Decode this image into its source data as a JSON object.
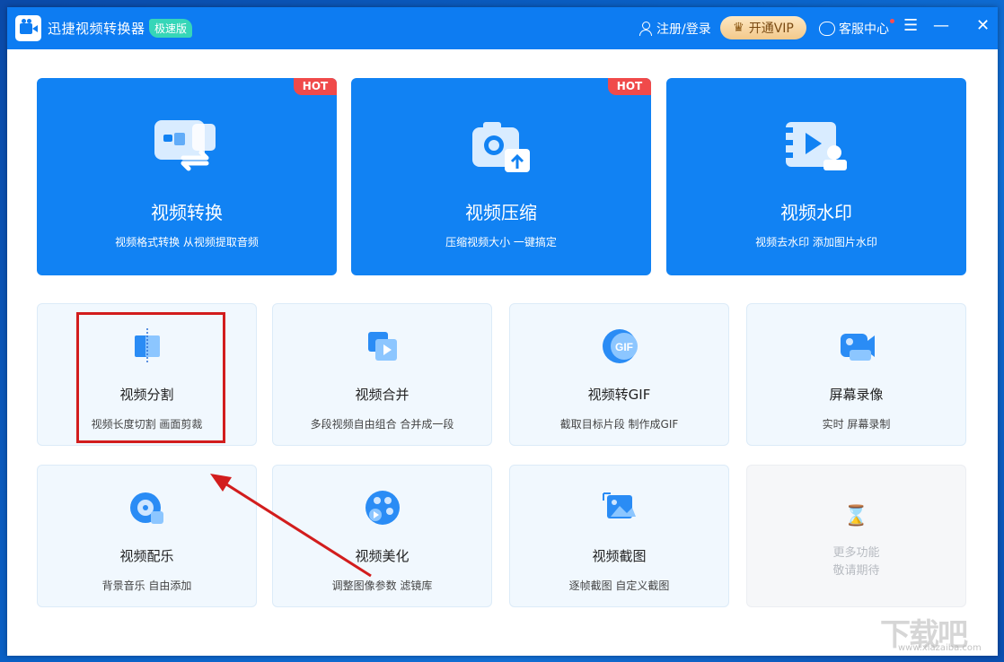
{
  "titlebar": {
    "app_title": "迅捷视频转换器",
    "edition": "极速版",
    "login": "注册/登录",
    "vip": "开通VIP",
    "service": "客服中心",
    "menu_glyph": "☰",
    "minimize_glyph": "—",
    "close_glyph": "✕"
  },
  "big_cards": [
    {
      "title": "视频转换",
      "desc": "视频格式转换 从视频提取音频",
      "badge": "HOT",
      "icon": "video-convert-icon"
    },
    {
      "title": "视频压缩",
      "desc": "压缩视频大小 一键搞定",
      "badge": "HOT",
      "icon": "video-compress-icon"
    },
    {
      "title": "视频水印",
      "desc": "视频去水印 添加图片水印",
      "icon": "video-watermark-icon"
    }
  ],
  "small_cards": [
    {
      "title": "视频分割",
      "desc": "视频长度切割 画面剪裁",
      "icon": "video-split-icon"
    },
    {
      "title": "视频合并",
      "desc": "多段视频自由组合 合并成一段",
      "icon": "video-merge-icon"
    },
    {
      "title": "视频转GIF",
      "desc": "截取目标片段 制作成GIF",
      "icon": "gif-icon",
      "icon_text": "GIF"
    },
    {
      "title": "屏幕录像",
      "desc": "实时 屏幕录制",
      "icon": "screen-record-icon"
    },
    {
      "title": "视频配乐",
      "desc": "背景音乐 自由添加",
      "icon": "music-icon"
    },
    {
      "title": "视频美化",
      "desc": "调整图像参数 滤镜库",
      "icon": "beautify-icon"
    },
    {
      "title": "视频截图",
      "desc": "逐帧截图 自定义截图",
      "icon": "screenshot-icon"
    }
  ],
  "more": {
    "line1": "更多功能",
    "line2": "敬请期待",
    "icon": "hourglass-icon",
    "glyph": "⌛"
  },
  "watermark": {
    "text": "下载吧",
    "sub": "www.xiazaiba.com"
  },
  "colors": {
    "accent": "#0d7cf2",
    "hot": "#f04a4a",
    "annotation": "#d21d1d"
  }
}
